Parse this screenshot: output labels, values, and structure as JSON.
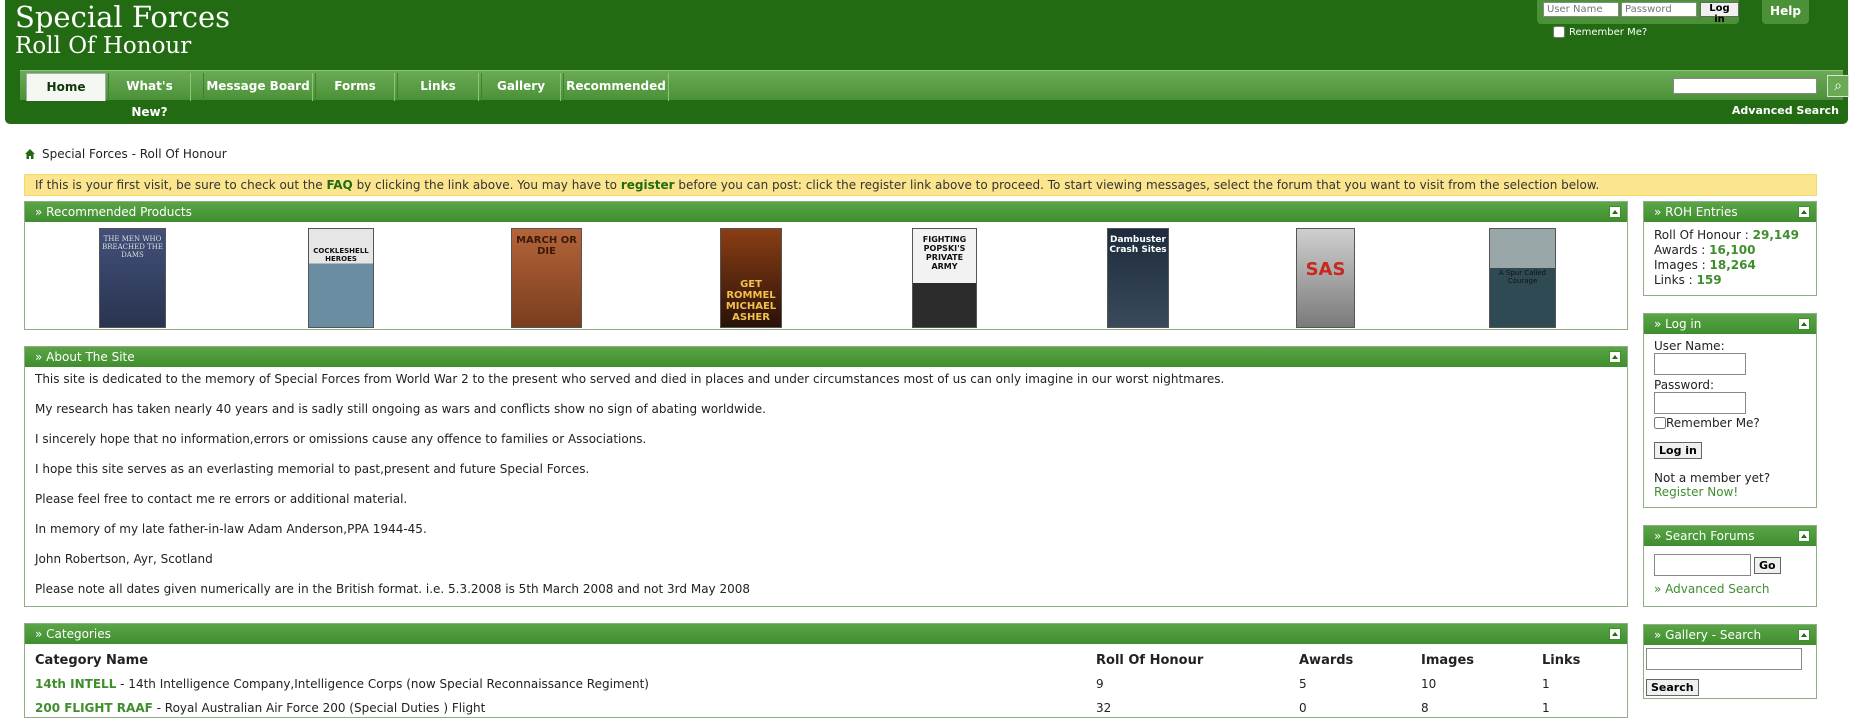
{
  "header": {
    "title_line1": "Special Forces",
    "title_line2": "Roll Of Honour",
    "username_placeholder": "User Name",
    "password_placeholder": "Password",
    "login_label": "Log in",
    "help_label": "Help",
    "remember_label": "Remember Me?",
    "advanced_search": "Advanced Search"
  },
  "nav": {
    "tabs": [
      "Home",
      "What's New?",
      "Message Board",
      "Forms",
      "Links",
      "Gallery",
      "Recommended"
    ],
    "active": "Home"
  },
  "breadcrumb": "Special Forces - Roll Of Honour",
  "notice": {
    "t1": "If this is your first visit, be sure to check out the ",
    "faq": "FAQ",
    "t2": " by clicking the link above. You may have to ",
    "register": "register",
    "t3": " before you can post: click the register link above to proceed. To start viewing messages, select the forum that you want to visit from the selection below."
  },
  "products": {
    "title": "» Recommended Products",
    "books": [
      {
        "title": "THE MEN WHO BREACHED THE DAMS",
        "color": "#3f4f7a"
      },
      {
        "title": "COCKLESHELL HEROES",
        "color": "#5d7b8e"
      },
      {
        "title": "MARCH OR DIE",
        "color": "#a25631"
      },
      {
        "title": "GET ROMMEL MICHAEL ASHER",
        "color": "#5a2a12"
      },
      {
        "title": "FIGHTING POPSKI'S PRIVATE ARMY",
        "color": "#e8e8e8"
      },
      {
        "title": "Dambuster Crash Sites",
        "color": "#1d2b3d"
      },
      {
        "title": "SAS",
        "color": "#b5b5b5"
      },
      {
        "title": "A Spur Called Courage",
        "color": "#3d5c66"
      }
    ]
  },
  "about": {
    "title": "» About The Site",
    "paragraphs": [
      "This site is dedicated to the memory of Special Forces from World War 2 to the present who served and died in places and under circumstances most of us can only imagine in our worst nightmares.",
      "My research has taken nearly 40 years and is sadly still ongoing as wars and conflicts show no sign of abating worldwide.",
      "I sincerely hope that no information,errors or omissions cause any offence to families or Associations.",
      "I hope this site serves as an everlasting memorial to past,present and future Special Forces.",
      "Please feel free to contact me re errors or additional material.",
      "In memory of my late father-in-law Adam Anderson,PPA 1944-45.",
      "John Robertson, Ayr, Scotland",
      "Please note all dates given numerically are in the British format.  i.e. 5.3.2008 is 5th March 2008 and not 3rd May 2008"
    ]
  },
  "categories": {
    "title": "» Categories",
    "headers": [
      "Category Name",
      "Roll Of Honour",
      "Awards",
      "Images",
      "Links"
    ],
    "rows": [
      {
        "name": "14th INTELL",
        "desc": " - 14th Intelligence Company,Intelligence Corps (now Special Reconnaissance Regiment)",
        "roh": "9",
        "awards": "5",
        "images": "10",
        "links": "1"
      },
      {
        "name": "200 FLIGHT RAAF",
        "desc": " - Royal Australian Air Force 200 (Special Duties ) Flight",
        "roh": "32",
        "awards": "0",
        "images": "8",
        "links": "1"
      }
    ]
  },
  "roh": {
    "title": "» ROH Entries",
    "stats": [
      {
        "label": "Roll Of Honour : ",
        "value": "29,149"
      },
      {
        "label": "Awards : ",
        "value": "16,100"
      },
      {
        "label": "Images : ",
        "value": "18,264"
      },
      {
        "label": "Links : ",
        "value": "159"
      }
    ]
  },
  "login_side": {
    "title": "» Log in",
    "user_label": "User Name:",
    "pass_label": "Password:",
    "remember": "Remember Me?",
    "button": "Log in",
    "not_member": "Not a member yet?",
    "register": "Register Now!"
  },
  "search_forums": {
    "title": "» Search Forums",
    "go": "Go",
    "advanced": "» Advanced Search"
  },
  "gallery_search": {
    "title": "» Gallery - Search",
    "button": "Search"
  }
}
